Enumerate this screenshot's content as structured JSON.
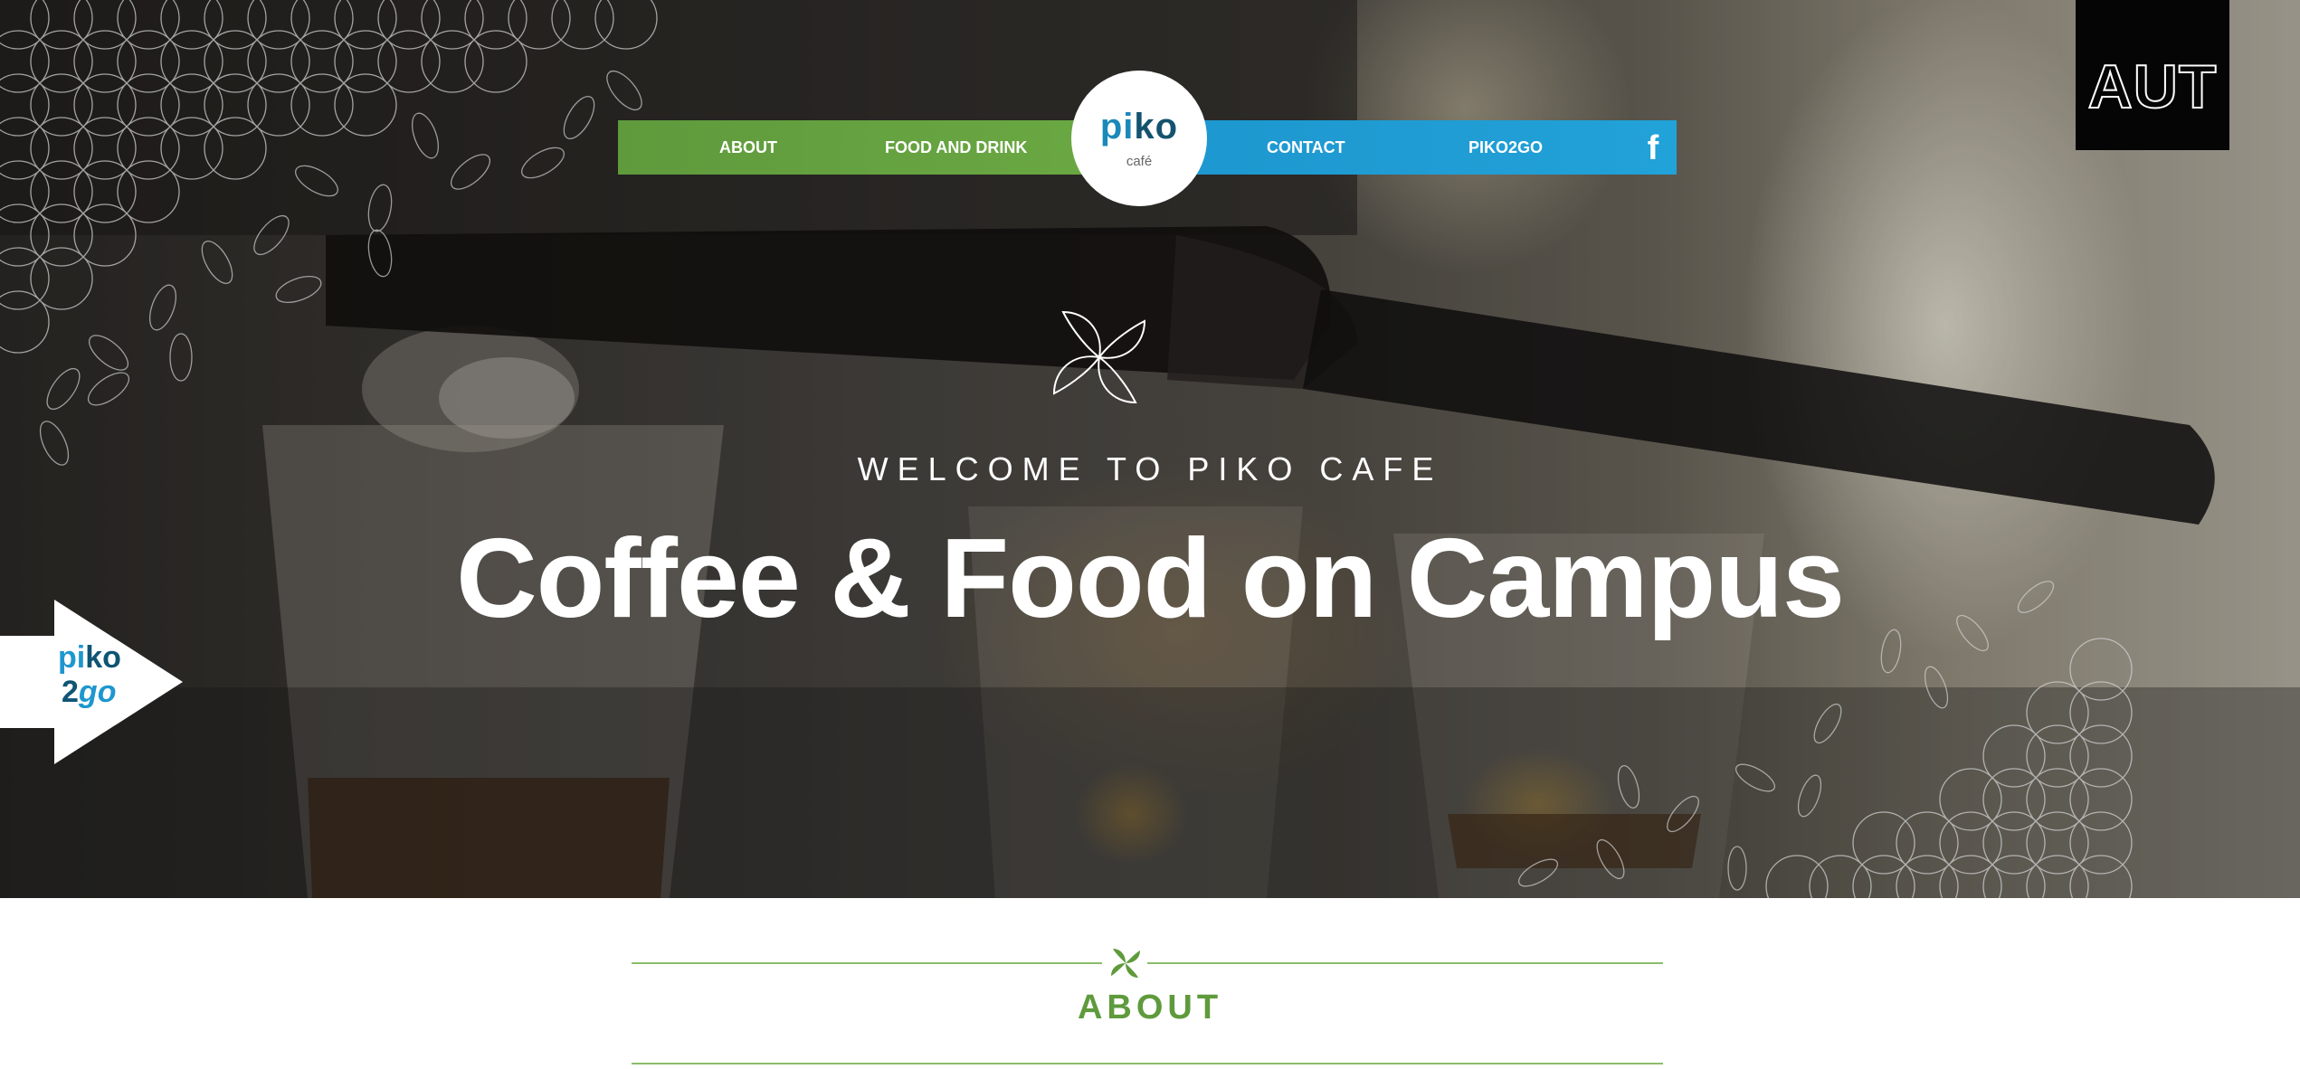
{
  "nav": {
    "items": [
      {
        "label": "ABOUT"
      },
      {
        "label": "FOOD AND DRINK"
      },
      {
        "label": "CONTACT"
      },
      {
        "label": "PIKO2GO"
      }
    ],
    "logo": {
      "word_pi": "pi",
      "word_ko": "ko",
      "sub": "café"
    },
    "facebook_icon": "facebook-icon",
    "facebook_glyph": "f",
    "colors": {
      "green": "#6aa843",
      "blue": "#21a2d8"
    }
  },
  "badge": {
    "label": "AUT"
  },
  "hero": {
    "welcome": "WELCOME TO PIKO CAFE",
    "headline": "Coffee & Food on Campus",
    "flower_icon": "four-petal-flower-icon"
  },
  "piko2go_arrow": {
    "line1_pi": "pi",
    "line1_ko": "ko",
    "line2_two": "2",
    "line2_go": "go"
  },
  "about": {
    "title": "ABOUT",
    "icon": "green-flower-icon",
    "accent": "#5f9a3c"
  }
}
